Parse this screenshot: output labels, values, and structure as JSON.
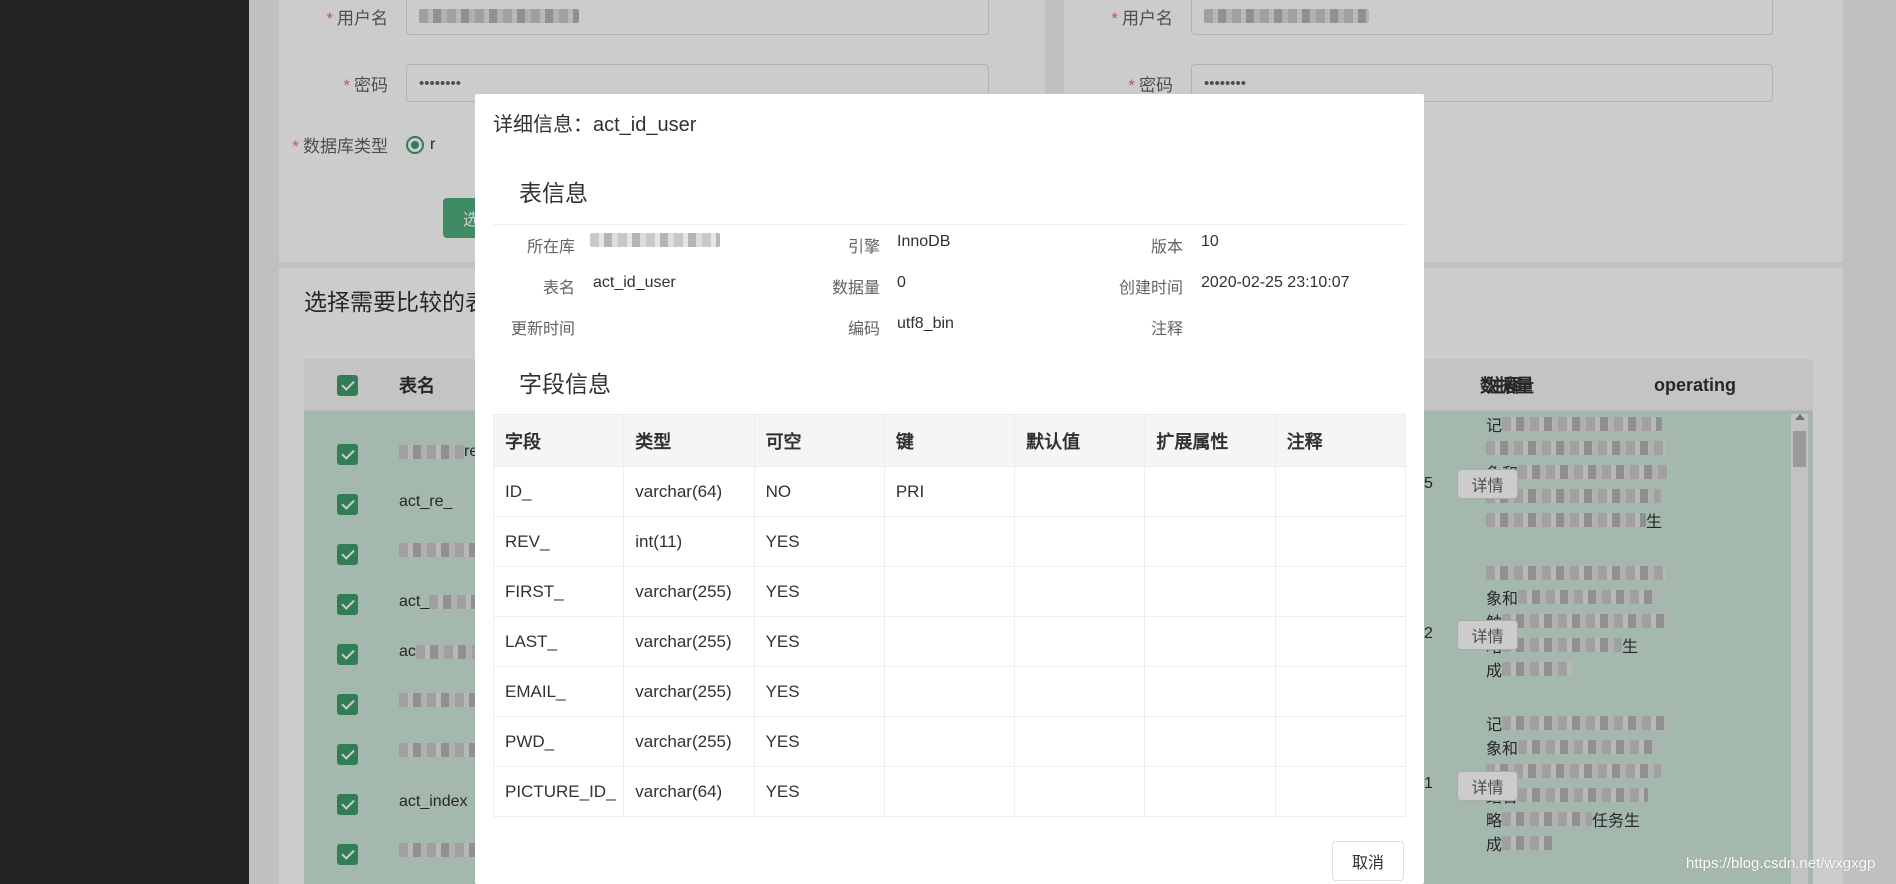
{
  "form_left": {
    "username_label": "用户名",
    "password_label": "密码",
    "password_value": "••••••••",
    "dbtype_label": "数据库类型",
    "dbtype_value": "r",
    "select_button": "选"
  },
  "form_right": {
    "username_label": "用户名",
    "password_label": "密码",
    "password_value": "••••••••"
  },
  "required_mark": "*",
  "section": {
    "title": "选择需要比较的表",
    "columns": {
      "name": "表名",
      "count": "数据量",
      "comment": "注释",
      "operating": "operating"
    },
    "rows": [
      {
        "name": "re"
      },
      {
        "name": "act_re_"
      },
      {
        "name": ""
      },
      {
        "name": "act_"
      },
      {
        "name": "ac"
      },
      {
        "name": ""
      },
      {
        "name": ""
      },
      {
        "name": "act_index"
      },
      {
        "name": ""
      }
    ],
    "right_counts": [
      "5",
      "2",
      "1"
    ],
    "comment_snippets": [
      [
        "记",
        "象和",
        "结",
        "生"
      ],
      [
        "象和",
        "触",
        "略",
        "生",
        "成"
      ],
      [
        "记",
        "象和",
        "结合",
        "略",
        "任务生",
        "成"
      ]
    ],
    "detail_label": "详情"
  },
  "dialog": {
    "title": "详细信息：act_id_user",
    "table_info_title": "表信息",
    "info": {
      "database_label": "所在库",
      "engine_label": "引擎",
      "engine_value": "InnoDB",
      "version_label": "版本",
      "version_value": "10",
      "table_name_label": "表名",
      "table_name_value": "act_id_user",
      "rows_label": "数据量",
      "rows_value": "0",
      "created_label": "创建时间",
      "created_value": "2020-02-25 23:10:07",
      "updated_label": "更新时间",
      "encoding_label": "编码",
      "encoding_value": "utf8_bin",
      "comment_label": "注释"
    },
    "field_info_title": "字段信息",
    "field_columns": [
      "字段",
      "类型",
      "可空",
      "键",
      "默认值",
      "扩展属性",
      "注释"
    ],
    "fields": [
      [
        "ID_",
        "varchar(64)",
        "NO",
        "PRI",
        "",
        "",
        ""
      ],
      [
        "REV_",
        "int(11)",
        "YES",
        "",
        "",
        "",
        ""
      ],
      [
        "FIRST_",
        "varchar(255)",
        "YES",
        "",
        "",
        "",
        ""
      ],
      [
        "LAST_",
        "varchar(255)",
        "YES",
        "",
        "",
        "",
        ""
      ],
      [
        "EMAIL_",
        "varchar(255)",
        "YES",
        "",
        "",
        "",
        ""
      ],
      [
        "PWD_",
        "varchar(255)",
        "YES",
        "",
        "",
        "",
        ""
      ],
      [
        "PICTURE_ID_",
        "varchar(64)",
        "YES",
        "",
        "",
        "",
        ""
      ]
    ],
    "cancel_label": "取消"
  },
  "watermark": "https://blog.csdn.net/wxgxgp",
  "colors": {
    "accent": "#3f9d6b",
    "row_selected": "#cfe7da",
    "required": "#f56c6c"
  }
}
